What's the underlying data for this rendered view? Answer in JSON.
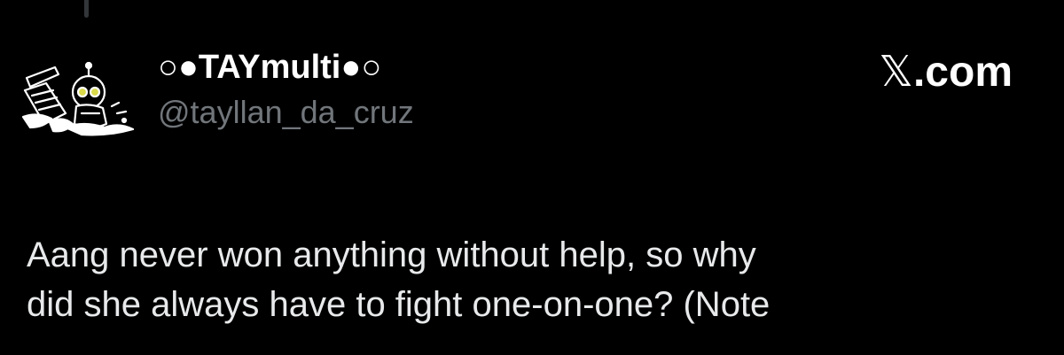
{
  "author": {
    "display_name": "○●TAYmulti●○",
    "handle": "@tayllan_da_cruz",
    "avatar_icon": "robot-character-icon"
  },
  "brand": {
    "logo_icon": "x-logo-icon",
    "logo_glyph": "𝕏",
    "label": ".com"
  },
  "tweet": {
    "lines": [
      "Aang never won anything without help, so why",
      "did she always have to fight one-on-one? (Note"
    ]
  },
  "colors": {
    "background": "#000000",
    "primary_text": "#e7e9ea",
    "secondary_text": "#71767b"
  }
}
